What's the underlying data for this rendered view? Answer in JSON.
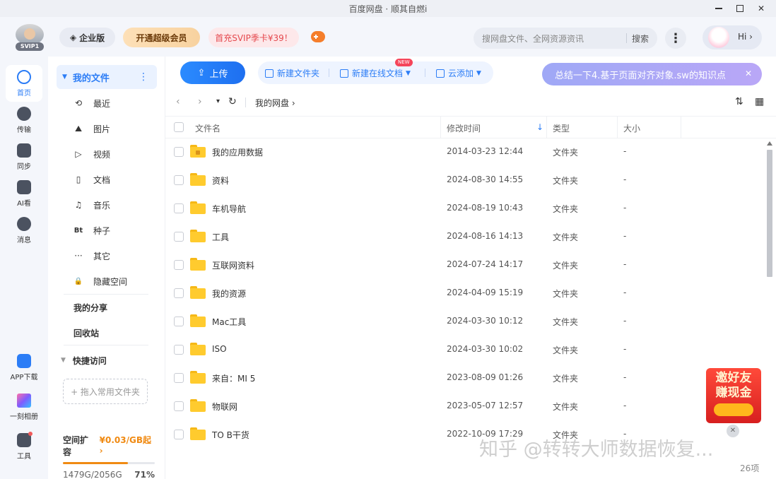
{
  "window": {
    "title": "百度网盘 · 顺其自燃i",
    "minimize_label": "",
    "close_label": "✕"
  },
  "header": {
    "avatar_badge": "SVIP1",
    "enterprise_label": "企业版",
    "vip_label": "开通超级会员",
    "svip_promo_label": "首充SVIP季卡¥39！",
    "search_placeholder": "搜网盘文件、全网资源资讯",
    "search_button": "搜索",
    "more_label": "⋮",
    "hi_label": "Hi ›"
  },
  "rail": {
    "items": [
      {
        "label": "首页"
      },
      {
        "label": "传输"
      },
      {
        "label": "同步"
      },
      {
        "label": "AI看"
      },
      {
        "label": "消息"
      }
    ],
    "bottom": [
      {
        "label": "APP下载"
      },
      {
        "label": "一刻相册"
      },
      {
        "label": "工具"
      }
    ]
  },
  "sidebar": {
    "my_files": "我的文件",
    "sub_items": [
      {
        "icon": "⟲",
        "label": "最近"
      },
      {
        "icon": "⛰",
        "label": "图片"
      },
      {
        "icon": "▷",
        "label": "视频"
      },
      {
        "icon": "▯",
        "label": "文档"
      },
      {
        "icon": "♫",
        "label": "音乐"
      },
      {
        "icon": "Bt",
        "label": "种子"
      },
      {
        "icon": "···",
        "label": "其它"
      },
      {
        "icon": "🔒",
        "label": "隐藏空间"
      }
    ],
    "my_share": "我的分享",
    "recycle": "回收站",
    "quick_access": "快捷访问",
    "drop_hint": "+ 拖入常用文件夹",
    "storage": {
      "label": "空间扩容",
      "price": "¥0.03/GB起 ›",
      "used_text": "1479G/2056G",
      "percent_text": "71%",
      "percent": 71
    }
  },
  "toolbar": {
    "upload": "上传",
    "new_folder": "新建文件夹",
    "new_online_doc": "新建在线文档",
    "new_badge": "NEW",
    "cloud_add": "云添加",
    "ai_banner": "总结一下4.基于页面对齐对象.sw的知识点"
  },
  "nav": {
    "back": "‹",
    "forward": "›",
    "dropdown": "▾",
    "refresh": "↻",
    "breadcrumb": "我的网盘 ›",
    "sort_icon": "⇅",
    "grid_icon": "▦"
  },
  "table": {
    "columns": {
      "name": "文件名",
      "mtime": "修改时间",
      "sort_arrow": "↓",
      "type": "类型",
      "size": "大小"
    },
    "rows": [
      {
        "name": "我的应用数据",
        "mtime": "2014-03-23 12:44",
        "type": "文件夹",
        "size": "-",
        "locked": true
      },
      {
        "name": "资料",
        "mtime": "2024-08-30 14:55",
        "type": "文件夹",
        "size": "-"
      },
      {
        "name": "车机导航",
        "mtime": "2024-08-19 10:43",
        "type": "文件夹",
        "size": "-"
      },
      {
        "name": "工具",
        "mtime": "2024-08-16 14:13",
        "type": "文件夹",
        "size": "-"
      },
      {
        "name": "互联网资料",
        "mtime": "2024-07-24 14:17",
        "type": "文件夹",
        "size": "-"
      },
      {
        "name": "我的资源",
        "mtime": "2024-04-09 15:19",
        "type": "文件夹",
        "size": "-"
      },
      {
        "name": "Mac工具",
        "mtime": "2024-03-30 10:12",
        "type": "文件夹",
        "size": "-"
      },
      {
        "name": "ISO",
        "mtime": "2024-03-30 10:02",
        "type": "文件夹",
        "size": "-"
      },
      {
        "name": "来自：MI 5",
        "mtime": "2023-08-09 01:26",
        "type": "文件夹",
        "size": "-"
      },
      {
        "name": "物联网",
        "mtime": "2023-05-07 12:57",
        "type": "文件夹",
        "size": "-"
      },
      {
        "name": "TO B干货",
        "mtime": "2022-10-09 17:29",
        "type": "文件夹",
        "size": "-"
      }
    ]
  },
  "promo": {
    "line1": "邀好友",
    "line2": "赚现金",
    "close": "✕"
  },
  "watermark": "知乎 @转转大师数据恢复...",
  "item_count": "26项"
}
